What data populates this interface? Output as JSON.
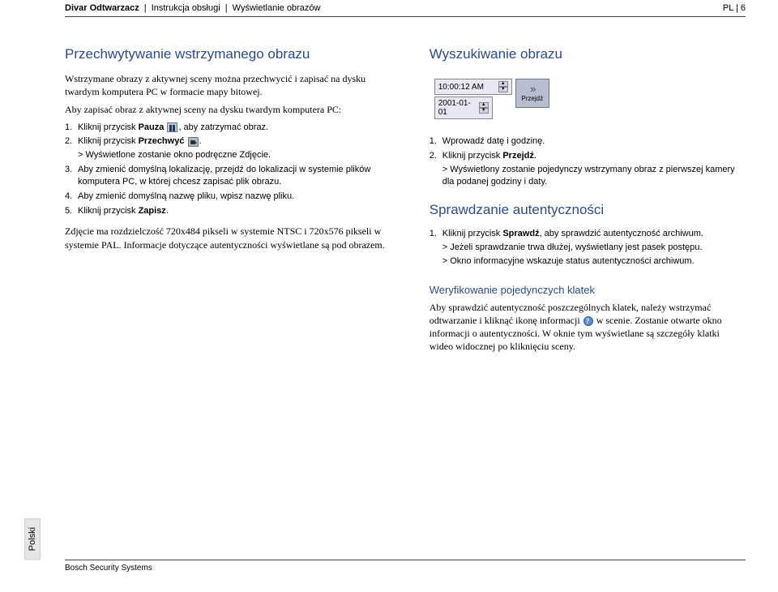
{
  "header": {
    "product": "Divar Odtwarzacz",
    "sep1": " | ",
    "doc": "Instrukcja obsługi",
    "sep2": " | ",
    "section": "Wyświetlanie obrazów",
    "right": "PL | 6"
  },
  "left": {
    "h2": "Przechwytywanie wstrzymanego obrazu",
    "intro": "Wstrzymane obrazy z aktywnej sceny można przechwycić i zapisać na dysku twardym komputera PC w formacie mapy bitowej.",
    "intro2": "Aby zapisać obraz z aktywnej sceny na dysku twardym komputera PC:",
    "steps": [
      {
        "n": "1.",
        "pre": "Kliknij przycisk ",
        "bold": "Pauza",
        "post": ", aby zatrzymać obraz."
      },
      {
        "n": "2.",
        "pre": "Kliknij przycisk ",
        "bold": "Przechwyć",
        "post": ".",
        "sub": "> Wyświetlone zostanie okno podręczne Zdjęcie."
      },
      {
        "n": "3.",
        "pre": "Aby zmienić domyślną lokalizację, przejdź do lokalizacji w systemie plików komputera PC, w której chcesz zapisać plik obrazu.",
        "bold": "",
        "post": ""
      },
      {
        "n": "4.",
        "pre": "Aby zmienić domyślną nazwę pliku, wpisz nazwę pliku.",
        "bold": "",
        "post": ""
      },
      {
        "n": "5.",
        "pre": "Kliknij przycisk ",
        "bold": "Zapisz",
        "post": "."
      }
    ],
    "note": "Zdjęcie ma rozdzielczość 720x484 pikseli w systemie NTSC i 720x576 pikseli w systemie PAL. Informacje dotyczące autentyczności wyświetlane są pod obrazem."
  },
  "right": {
    "h2_search": "Wyszukiwanie obrazu",
    "widget": {
      "time": "10:00:12 AM",
      "date": "2001-01-01",
      "go": "Przejdź"
    },
    "search_steps": [
      {
        "n": "1.",
        "pre": "Wprowadź datę i godzinę.",
        "bold": "",
        "post": ""
      },
      {
        "n": "2.",
        "pre": "Kliknij przycisk ",
        "bold": "Przejdź",
        "post": ".",
        "sub": "> Wyświetlony zostanie pojedynczy wstrzymany obraz z pierwszej kamery dla podanej godziny i daty."
      }
    ],
    "h2_auth": "Sprawdzanie autentyczności",
    "auth_steps": [
      {
        "n": "1.",
        "pre": "Kliknij przycisk ",
        "bold": "Sprawdź",
        "post": ", aby sprawdzić autentyczność archiwum.",
        "sub1": "> Jeżeli sprawdzanie trwa dłużej, wyświetlany jest pasek postępu.",
        "sub2": "> Okno informacyjne wskazuje status autentyczności archiwum."
      }
    ],
    "h3_verify": "Weryfikowanie pojedynczych klatek",
    "verify_p1": "Aby sprawdzić autentyczność poszczególnych klatek, należy wstrzymać odtwarzanie i kliknąć ikonę informacji ",
    "verify_p2": " w scenie. Zostanie otwarte okno informacji o autentyczności. W oknie tym wyświetlane są szczegóły klatki wideo widocznej po kliknięciu sceny."
  },
  "sidebar": {
    "label": "Polski"
  },
  "footer": {
    "company": "Bosch Security Systems"
  }
}
